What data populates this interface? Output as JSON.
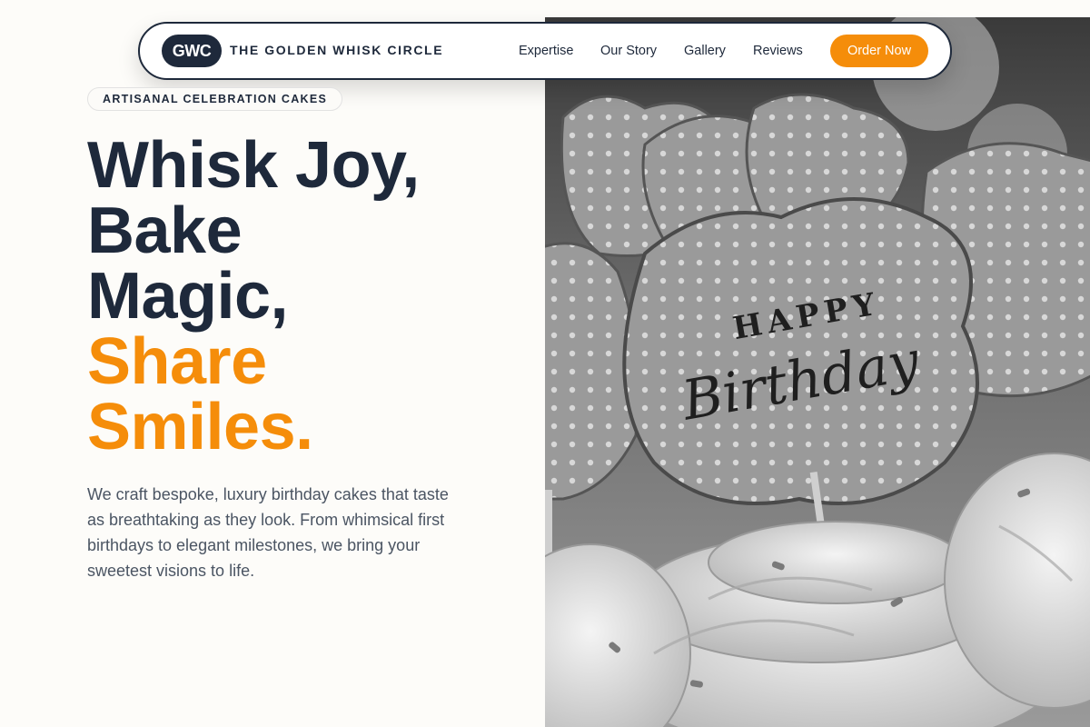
{
  "nav": {
    "logo_text": "GWC",
    "brand_name": "THE GOLDEN WHISK CIRCLE",
    "links": [
      "Expertise",
      "Our Story",
      "Gallery",
      "Reviews"
    ],
    "cta_label": "Order Now"
  },
  "hero": {
    "eyebrow": "ARTISANAL CELEBRATION CAKES",
    "headline_lines": [
      "Whisk Joy,",
      "Bake",
      "Magic,"
    ],
    "headline_accent_lines": [
      "Share",
      "Smiles."
    ],
    "description": "We craft bespoke, luxury birthday cakes that taste as breathtaking as they look. From whimsical first birthdays to elegant milestones, we bring your sweetest visions to life.",
    "image": {
      "topper_text_small": "HAPPY",
      "topper_text_script": "Birthday"
    }
  },
  "colors": {
    "primary": "#1e293b",
    "accent": "#f58d0a",
    "background": "#fdfcf9",
    "body_text": "#4b5563"
  }
}
